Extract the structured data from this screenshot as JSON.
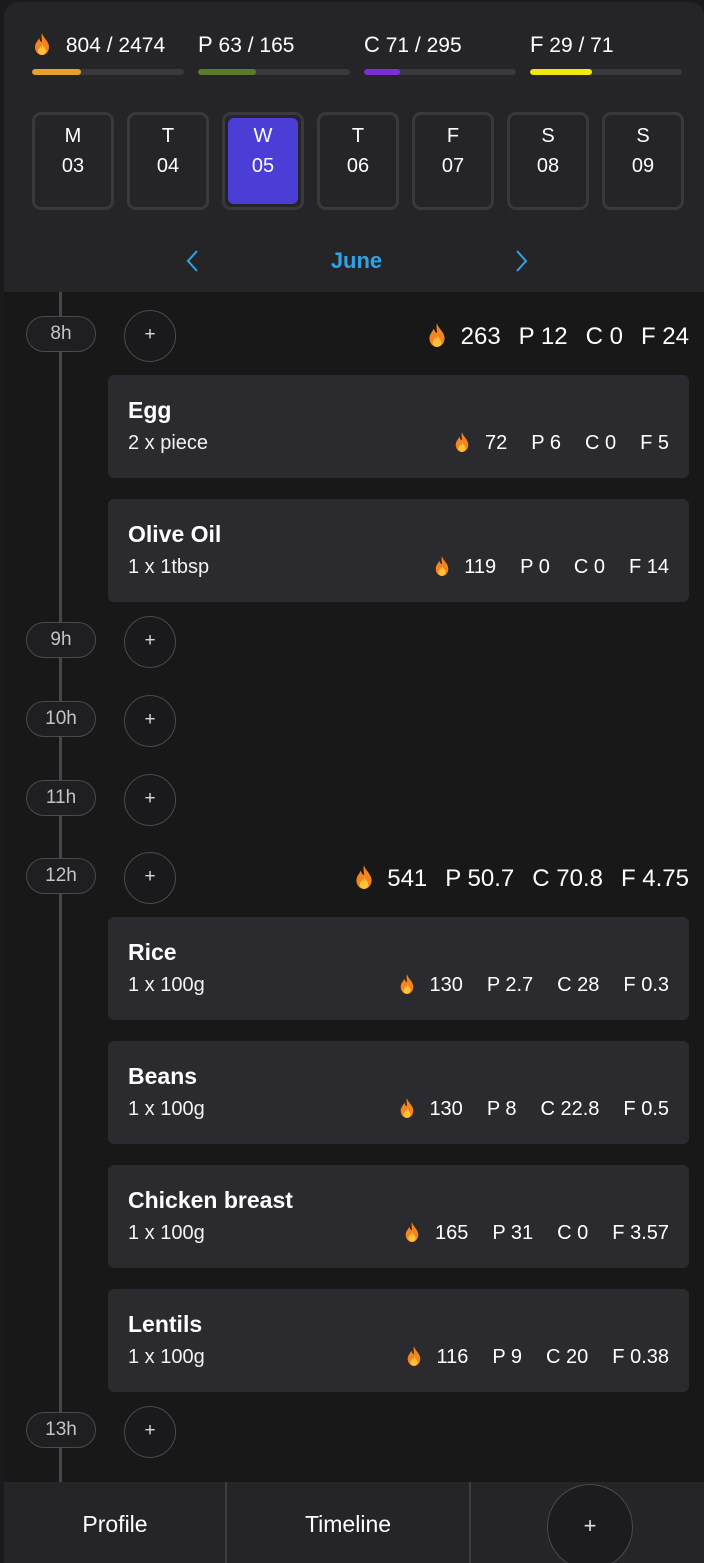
{
  "header": {
    "calories": {
      "consumed": "804",
      "goal": "2474",
      "color": "#e6a12c",
      "fraction": 0.325
    },
    "protein": {
      "letter": "P",
      "consumed": "63",
      "goal": "165",
      "color": "#5b7a2e",
      "fraction": 0.38
    },
    "carbs": {
      "letter": "C",
      "consumed": "71",
      "goal": "295",
      "color": "#7a2fd6",
      "fraction": 0.24
    },
    "fat": {
      "letter": "F",
      "consumed": "29",
      "goal": "71",
      "color": "#f0e80f",
      "fraction": 0.41
    }
  },
  "days": [
    {
      "letter": "M",
      "num": "03"
    },
    {
      "letter": "T",
      "num": "04"
    },
    {
      "letter": "W",
      "num": "05",
      "active": true
    },
    {
      "letter": "T",
      "num": "06"
    },
    {
      "letter": "F",
      "num": "07"
    },
    {
      "letter": "S",
      "num": "08"
    },
    {
      "letter": "S",
      "num": "09"
    }
  ],
  "month": "June",
  "colors": {
    "accent": "#4a3ed6",
    "month": "#2fa3e6",
    "flame_outer": "#f5831f",
    "flame_inner": "#ffc23a"
  },
  "add_symbol": "+",
  "timeline": {
    "h8": {
      "label": "8h",
      "summary": {
        "kcal": "263",
        "p": "P 12",
        "c": "C 0",
        "f": "F 24"
      },
      "items": [
        {
          "name": "Egg",
          "qty": "2 x piece",
          "kcal": "72",
          "p": "P 6",
          "c": "C 0",
          "f": "F 5"
        },
        {
          "name": "Olive Oil",
          "qty": "1 x 1tbsp",
          "kcal": "119",
          "p": "P 0",
          "c": "C 0",
          "f": "F 14"
        }
      ]
    },
    "h9": {
      "label": "9h"
    },
    "h10": {
      "label": "10h"
    },
    "h11": {
      "label": "11h"
    },
    "h12": {
      "label": "12h",
      "summary": {
        "kcal": "541",
        "p": "P 50.7",
        "c": "C 70.8",
        "f": "F 4.75"
      },
      "items": [
        {
          "name": "Rice",
          "qty": "1 x 100g",
          "kcal": "130",
          "p": "P 2.7",
          "c": "C 28",
          "f": "F 0.3"
        },
        {
          "name": "Beans",
          "qty": "1 x 100g",
          "kcal": "130",
          "p": "P 8",
          "c": "C 22.8",
          "f": "F 0.5"
        },
        {
          "name": "Chicken breast",
          "qty": "1 x 100g",
          "kcal": "165",
          "p": "P 31",
          "c": "C 0",
          "f": "F 3.57"
        },
        {
          "name": "Lentils",
          "qty": "1 x 100g",
          "kcal": "116",
          "p": "P 9",
          "c": "C 20",
          "f": "F 0.38"
        }
      ]
    },
    "h13": {
      "label": "13h"
    }
  },
  "bottom": {
    "profile": "Profile",
    "timeline": "Timeline",
    "add": "+"
  }
}
